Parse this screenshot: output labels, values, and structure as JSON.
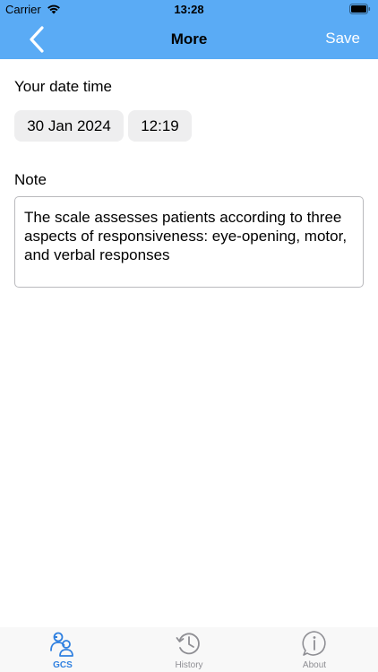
{
  "status_bar": {
    "carrier": "Carrier",
    "time": "13:28"
  },
  "nav": {
    "title": "More",
    "save_label": "Save"
  },
  "form": {
    "datetime_label": "Your date time",
    "date_value": "30 Jan 2024",
    "time_value": "12:19",
    "note_label": "Note",
    "note_value": "The scale assesses patients according to three aspects of responsiveness: eye-opening, motor, and verbal responses"
  },
  "tabs": [
    {
      "label": "GCS",
      "icon": "patients-icon",
      "active": true
    },
    {
      "label": "History",
      "icon": "history-clock-icon",
      "active": false
    },
    {
      "label": "About",
      "icon": "info-bubble-icon",
      "active": false
    }
  ],
  "colors": {
    "header": "#5aabf5",
    "accent": "#2f80e0",
    "inactive": "#8e8e93",
    "chip": "#eeeeef"
  }
}
